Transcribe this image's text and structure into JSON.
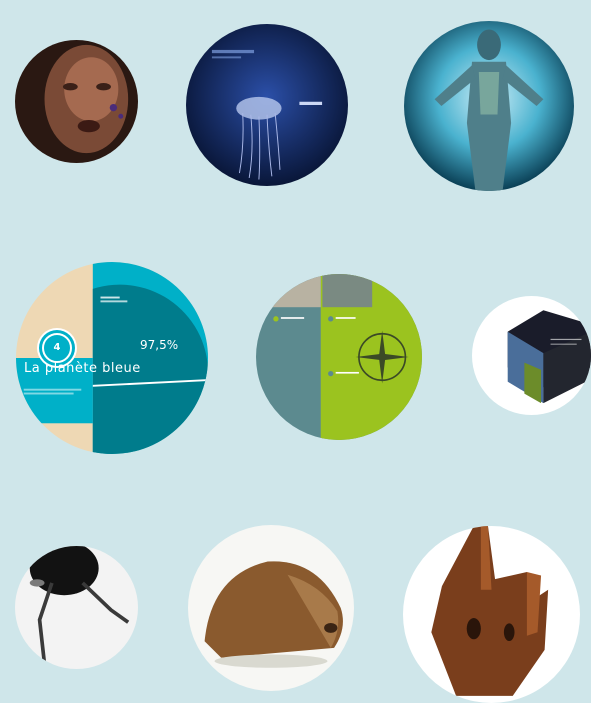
{
  "tiles": [
    {
      "name": "portrait-face-tile"
    },
    {
      "name": "jellyfish-tile"
    },
    {
      "name": "human-xray-tile"
    },
    {
      "name": "blue-planet-tile"
    },
    {
      "name": "compass-tile"
    },
    {
      "name": "cube-tile"
    },
    {
      "name": "beetle-tile"
    },
    {
      "name": "hedgehog-tile"
    },
    {
      "name": "wooden-mask-tile"
    }
  ],
  "planet": {
    "badge": "4",
    "title": "La planète bleue",
    "percent": "97,5%"
  },
  "colors": {
    "background": "#cfe6ea",
    "teal": "#007c8c",
    "cyan": "#00b0c8",
    "green": "#9bc31f",
    "slate": "#5c8a8f"
  }
}
